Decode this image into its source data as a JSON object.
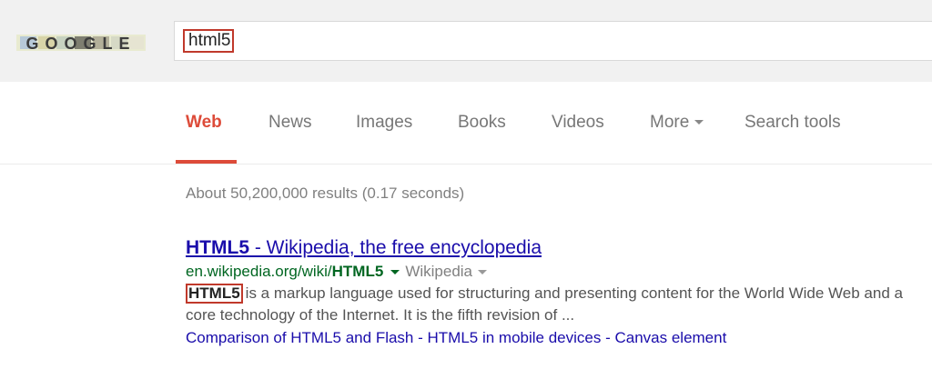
{
  "header": {
    "logo_text": "GOOGLE",
    "search_query": "html5"
  },
  "tabs": [
    {
      "label": "Web",
      "active": true
    },
    {
      "label": "News"
    },
    {
      "label": "Images"
    },
    {
      "label": "Books"
    },
    {
      "label": "Videos"
    },
    {
      "label": "More"
    },
    {
      "label": "Search tools"
    }
  ],
  "stats": "About 50,200,000 results (0.17 seconds)",
  "result": {
    "title_bold": "HTML5",
    "title_rest": " - Wikipedia, the free encyclopedia",
    "url_prefix": "en.wikipedia.org/wiki/",
    "url_bold": "HTML5",
    "source": "Wikipedia",
    "snippet_highlight": "HTML5",
    "snippet_text": "is a markup language used for structuring and presenting content for the World Wide Web and a core technology of the Internet. It is the fifth revision of ...",
    "sitelinks": [
      "Comparison of HTML5 and Flash",
      "HTML5 in mobile devices",
      "Canvas element"
    ],
    "sitelink_separator": " - "
  },
  "colors": {
    "accent_red": "#dd4b39",
    "link_blue": "#1a0dab",
    "url_green": "#006621",
    "highlight_box": "#c0392b"
  }
}
